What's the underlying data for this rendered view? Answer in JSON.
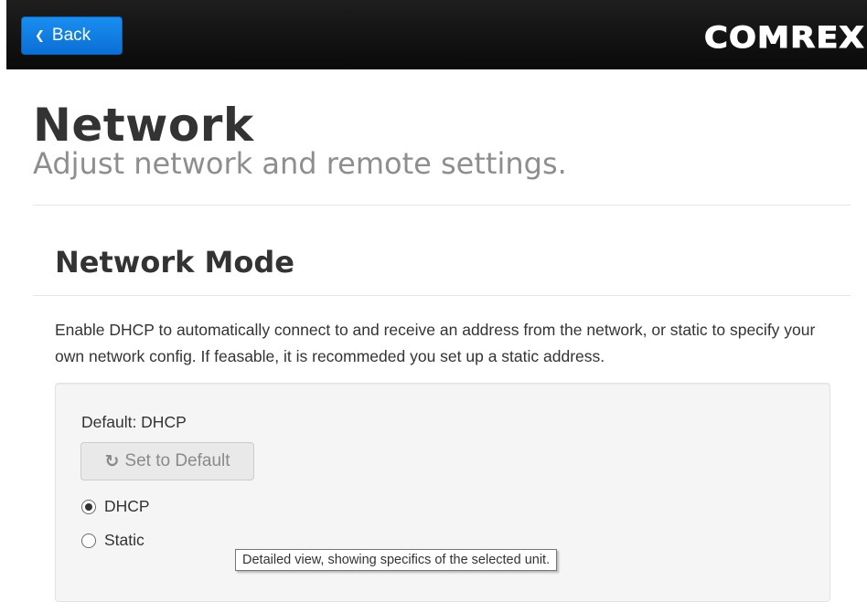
{
  "topbar": {
    "back_label": "Back",
    "logo_text": "COMREX"
  },
  "page": {
    "title": "Network",
    "subtitle": "Adjust network and remote settings."
  },
  "section": {
    "title": "Network Mode",
    "description": "Enable DHCP to automatically connect to and receive an address from the network, or static to specify your own network config. If feasable, it is recommeded you set up a static address."
  },
  "panel": {
    "default_label": "Default: DHCP",
    "set_default_label": "Set to Default",
    "options": [
      {
        "label": "DHCP",
        "selected": true
      },
      {
        "label": "Static",
        "selected": false
      }
    ]
  },
  "tooltip": {
    "text": "Detailed view, showing specifics of the selected unit."
  },
  "colors": {
    "accent": "#0a7de4",
    "topbar": "#111111"
  },
  "icons": {
    "back": "chevron-left-icon",
    "reset": "refresh-icon"
  }
}
